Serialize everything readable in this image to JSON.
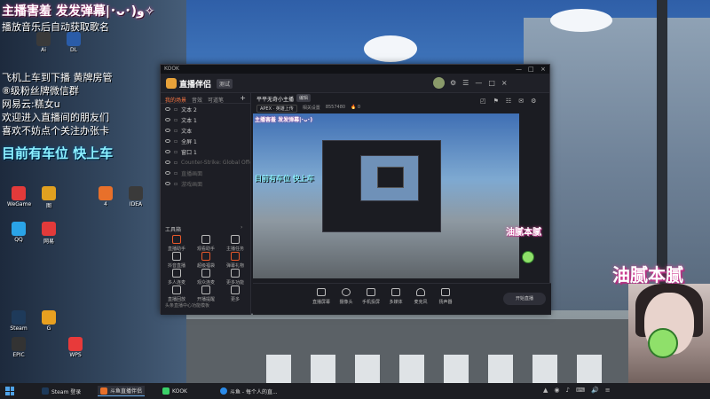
{
  "overlay": {
    "title": "主播害羞 发发弹幕|･ᴗ･)و✧",
    "subtitle": "播放音乐后自动获取歌名",
    "lines": [
      "飞机上车到下播 黄牌房管",
      "⑧级粉丝牌微信群",
      "网易云:糕女u",
      "欢迎进入直播间的朋友们",
      "喜欢不妨点个关注办张卡"
    ],
    "cars_text": "目前有车位 快上车",
    "greasy_small": "油腻本腻",
    "greasy_big": "油腻本腻"
  },
  "desktop_icons": [
    {
      "label": "Ai",
      "color": "#3a3a3a"
    },
    {
      "label": "DL",
      "color": "#2a5ca8"
    },
    {
      "label": "WeGame",
      "color": "#e23a3a"
    },
    {
      "label": "图",
      "color": "#e0a020"
    },
    {
      "label": "4",
      "color": "#e8702a"
    },
    {
      "label": "IDEA",
      "color": "#3a3a3a"
    },
    {
      "label": "QQ",
      "color": "#2aa4e8"
    },
    {
      "label": "网易",
      "color": "#e23a3a"
    },
    {
      "label": "Steam",
      "color": "#1e3a5a"
    },
    {
      "label": "G",
      "color": "#e8a020"
    },
    {
      "label": "EPIC",
      "color": "#333"
    },
    {
      "label": "WPS",
      "color": "#e83a3a"
    }
  ],
  "app": {
    "brand": "KOOK",
    "logo_text": "直播伴侣",
    "version_badge": "测试",
    "header_icons": [
      "⚙",
      "☰",
      "—",
      "□",
      "×"
    ],
    "left_tabs": [
      "我的场景",
      "音效",
      "可道笔"
    ],
    "add_icon": "+",
    "sources": [
      {
        "label": "文本 2",
        "dim": false
      },
      {
        "label": "文本 1",
        "dim": false
      },
      {
        "label": "文本",
        "dim": false
      },
      {
        "label": "全屏 1",
        "dim": false
      },
      {
        "label": "窗口 1",
        "dim": false
      },
      {
        "label": "Counter-Strike: Global Offensive - Direct3D 9",
        "dim": true
      },
      {
        "label": "直播画面",
        "dim": true
      },
      {
        "label": "游戏画面",
        "dim": true
      }
    ],
    "tools_title": "工具箱",
    "tools_more": "›",
    "tools": [
      {
        "label": "直播助手",
        "color": "#e8582a"
      },
      {
        "label": "观看助手",
        "color": "#bbb"
      },
      {
        "label": "主播任务",
        "color": "#bbb"
      },
      {
        "label": "抖音直播",
        "color": "#bbb"
      },
      {
        "label": "超级福袋",
        "color": "#e8582a"
      },
      {
        "label": "弹幕礼物",
        "color": "#e8582a"
      },
      {
        "label": "多人连麦",
        "color": "#bbb"
      },
      {
        "label": "观众连麦",
        "color": "#bbb"
      },
      {
        "label": "更多功能",
        "color": "#bbb"
      },
      {
        "label": "直播回放",
        "color": "#bbb"
      },
      {
        "label": "开播提醒",
        "color": "#bbb"
      },
      {
        "label": "更多",
        "color": "#bbb"
      }
    ],
    "footer": "头条直播中心功能模板",
    "room_title": "平平无奇小主播",
    "edit_label": "编辑",
    "meta": [
      "APEX · 英雄上传",
      "相关设置",
      "8557480",
      "🔥 0"
    ],
    "right_icons": [
      "◰",
      "⚑",
      "☷",
      "✉",
      "⚙"
    ],
    "preview_title": "主播害羞 发发弹幕|･ᴗ･)",
    "preview_cars": "目前有车位 快上车",
    "bottom_items": [
      "直播屏幕",
      "摄像头",
      "手机投屏",
      "多媒体",
      "麦克风",
      "扬声器"
    ],
    "start_label": "开始直播"
  },
  "taskbar": {
    "items": [
      {
        "label": "Steam 登录",
        "color": "#1e3a5a",
        "active": false
      },
      {
        "label": "斗鱼直播伴侣",
        "color": "#e8702a",
        "active": true
      },
      {
        "label": "KOOK",
        "color": "#3ad068",
        "active": false
      },
      {
        "label": "斗鱼 - 每个人的直...",
        "color": "#2a8ae8",
        "active": false
      }
    ],
    "tray_icons": [
      "▲",
      "◉",
      "♪",
      "⌨",
      "🔊",
      "≡"
    ]
  }
}
